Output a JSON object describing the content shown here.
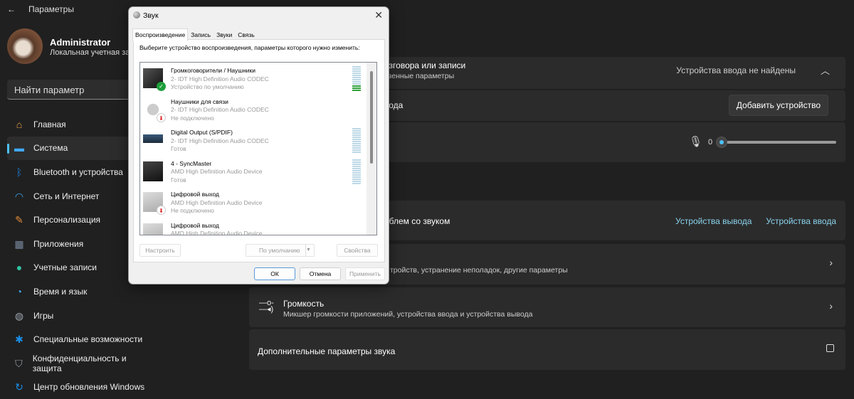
{
  "app": {
    "title": "Параметры"
  },
  "user": {
    "name": "Administrator",
    "account": "Локальная учетная запись"
  },
  "search": {
    "placeholder": "Найти параметр"
  },
  "nav": [
    {
      "label": "Главная",
      "icon": "home-icon",
      "color": "#e8a24a"
    },
    {
      "label": "Система",
      "icon": "system-icon",
      "color": "#3fa9f5",
      "selected": true
    },
    {
      "label": "Bluetooth и устройства",
      "icon": "bluetooth-icon",
      "color": "#1a7fe0"
    },
    {
      "label": "Сеть и Интернет",
      "icon": "wifi-icon",
      "color": "#3fa9f5"
    },
    {
      "label": "Персонализация",
      "icon": "brush-icon",
      "color": "#e08a3a"
    },
    {
      "label": "Приложения",
      "icon": "apps-icon",
      "color": "#7a8aa0"
    },
    {
      "label": "Учетные записи",
      "icon": "account-icon",
      "color": "#2ec4a0"
    },
    {
      "label": "Время и язык",
      "icon": "clock-globe-icon",
      "color": "#3fa9f5"
    },
    {
      "label": "Игры",
      "icon": "gamepad-icon",
      "color": "#9aa4b0"
    },
    {
      "label": "Специальные возможности",
      "icon": "accessibility-icon",
      "color": "#1a8fe8"
    },
    {
      "label": "Конфиденциальность и защита",
      "icon": "shield-icon",
      "color": "#9aa0a8"
    },
    {
      "label": "Центр обновления Windows",
      "icon": "update-icon",
      "color": "#1a8fe8"
    }
  ],
  "main": {
    "input_header": {
      "title": "азговора или записи",
      "subtitle": "твенные параметры",
      "status": "Устройства ввода не найдены"
    },
    "add_device": {
      "label": "вода",
      "button": "Добавить устройство"
    },
    "volume_value": "0",
    "troubleshoot": {
      "label": "облем со звуком",
      "link_output": "Устройства вывода",
      "link_input": "Устройства ввода"
    },
    "all_devices": {
      "subtitle": "тройств, устранение неполадок, другие параметры"
    },
    "volume_mixer": {
      "title": "Громкость",
      "subtitle": "Микшер громкости приложений, устройства ввода и устройства вывода"
    },
    "advanced": {
      "title": "Дополнительные параметры звука"
    }
  },
  "dialog": {
    "title": "Звук",
    "tabs": [
      "Воспроизведение",
      "Запись",
      "Звуки",
      "Связь"
    ],
    "instruction": "Выберите устройство воспроизведения, параметры которого нужно изменить:",
    "devices": [
      {
        "name": "Громкоговорители / Наушники",
        "driver": "2- IDT High Definition Audio CODEC",
        "status": "Устройство по умолчанию",
        "icon": "speaker-icon",
        "badge": "default",
        "level": 0.25
      },
      {
        "name": "Наушники для связи",
        "driver": "2- IDT High Definition Audio CODEC",
        "status": "Не подключено",
        "icon": "headphones-icon",
        "badge": "disconnected"
      },
      {
        "name": "Digital Output (S/PDIF)",
        "driver": "2- IDT High Definition Audio CODEC",
        "status": "Готов",
        "icon": "digital-output-icon",
        "level": 0
      },
      {
        "name": "4 - SyncMaster",
        "driver": "AMD High Definition Audio Device",
        "status": "Готов",
        "icon": "monitor-icon",
        "level": 0
      },
      {
        "name": "Цифровой выход",
        "driver": "AMD High Definition Audio Device",
        "status": "Не подключено",
        "icon": "monitor-icon",
        "badge": "disconnected"
      },
      {
        "name": "Цифровой выход",
        "driver": "AMD High Definition Audio Device",
        "status": "",
        "icon": "monitor-icon"
      }
    ],
    "configure": "Настроить",
    "set_default": "По умолчанию",
    "properties": "Свойства",
    "ok": "ОК",
    "cancel": "Отмена",
    "apply": "Применить"
  }
}
